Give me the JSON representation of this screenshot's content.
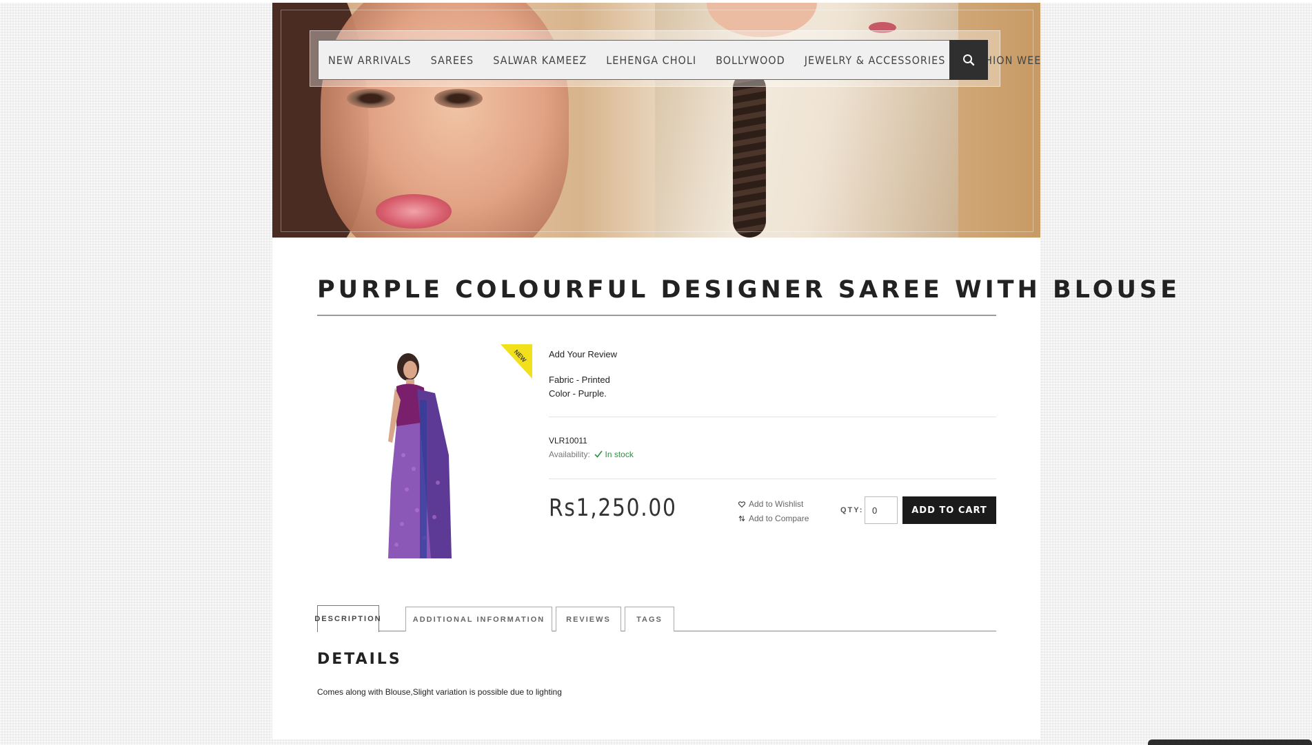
{
  "nav": {
    "items": [
      "NEW ARRIVALS",
      "SAREES",
      "SALWAR KAMEEZ",
      "LEHENGA CHOLI",
      "BOLLYWOOD",
      "JEWELRY & ACCESSORIES",
      "FASHION WEEK"
    ],
    "search_icon": "search-icon"
  },
  "product": {
    "title": "PURPLE COLOURFUL DESIGNER SAREE WITH BLOUSE",
    "badge": "NEW",
    "review_link": "Add Your Review",
    "description_lines": [
      "Fabric - Printed",
      "Color - Purple."
    ],
    "sku": "VLR10011",
    "availability_label": "Availability:",
    "availability_value": "In stock",
    "price": "Rs1,250.00",
    "wishlist": "Add to Wishlist",
    "compare": "Add to Compare",
    "qty_label": "QTY:",
    "qty_value": "0",
    "add_to_cart": "ADD TO CART"
  },
  "tabs": [
    "DESCRIPTION",
    "ADDITIONAL INFORMATION",
    "REVIEWS",
    "TAGS"
  ],
  "details": {
    "heading": "DETAILS",
    "text": "Comes along with Blouse,Slight variation is possible due to lighting"
  },
  "colors": {
    "accent_dark": "#1b1b1b",
    "stock_green": "#2f8f3e",
    "badge_yellow": "#f2e01a"
  }
}
